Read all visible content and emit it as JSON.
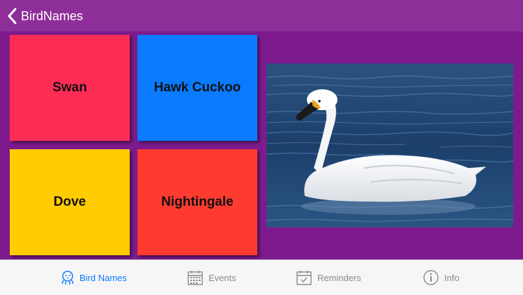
{
  "navbar": {
    "back_title": "BirdNames"
  },
  "tiles": [
    {
      "label": "Swan"
    },
    {
      "label": "Hawk Cuckoo"
    },
    {
      "label": "Dove"
    },
    {
      "label": "Nightingale"
    }
  ],
  "photo": {
    "subject": "swan",
    "icon": "swan-photo"
  },
  "tabs": [
    {
      "label": "Bird Names",
      "icon": "bird-icon",
      "active": true
    },
    {
      "label": "Events",
      "icon": "calendar-icon",
      "active": false
    },
    {
      "label": "Reminders",
      "icon": "reminder-calendar-icon",
      "active": false
    },
    {
      "label": "Info",
      "icon": "info-icon",
      "active": false
    }
  ],
  "colors": {
    "navbar": "#8e2e99",
    "background": "#7d1b8e",
    "swan_tile": "#ff2d55",
    "hawk_cuckoo_tile": "#0a7aff",
    "dove_tile": "#ffcc00",
    "nightingale_tile": "#ff3b30",
    "tab_active": "#0a7aff",
    "tab_inactive": "#8a8a8e"
  }
}
